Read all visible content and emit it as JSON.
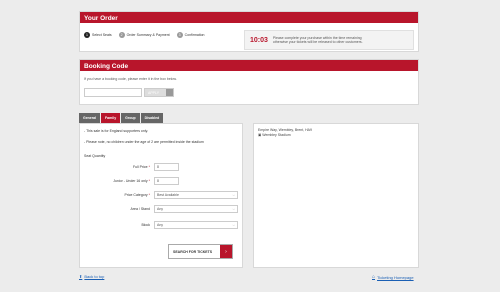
{
  "your_order": {
    "title": "Your Order",
    "steps": [
      {
        "num": "1",
        "label": "Select Seats"
      },
      {
        "num": "2",
        "label": "Order Summary & Payment"
      },
      {
        "num": "3",
        "label": "Confirmation"
      }
    ],
    "timer": "10:03",
    "timer_message_line1": "Please complete your purchase within the time remaining",
    "timer_message_line2": "otherwise your tickets will be released to other customers."
  },
  "booking_code": {
    "title": "Booking Code",
    "instruction": "If you have a booking code, please enter it in the box below.",
    "input_value": "",
    "apply_label": "APPLY"
  },
  "tabs": [
    {
      "label": "General",
      "active": false
    },
    {
      "label": "Family",
      "active": true
    },
    {
      "label": "Group",
      "active": false
    },
    {
      "label": "Disabled",
      "active": false
    }
  ],
  "form": {
    "note1": "- This sale is for England supporters only.",
    "note2": "- Please note, no children under the age of 2 are permitted inside the stadium",
    "seat_quantity_label": "Seat Quantity",
    "full_price_label": "Full Price",
    "full_price_value": "0",
    "junior_label": "Junior - Under 16 only",
    "junior_value": "0",
    "price_category_label": "Price Category",
    "price_category_value": "Best Available",
    "area_label": "Area / Stand",
    "area_value": "Any",
    "block_label": "Block",
    "block_value": "Any",
    "search_label": "SEARCH FOR TICKETS",
    "required_mark": "*"
  },
  "venue": {
    "address": "Empire Way, Wembley, Brent, HA9",
    "image_alt": "Wembley Stadium"
  },
  "footer": {
    "back_to_top": "Back to top",
    "ticketing_homepage": "Ticketing Homepage"
  },
  "colors": {
    "accent": "#b8152b",
    "link": "#1a5fb4"
  }
}
